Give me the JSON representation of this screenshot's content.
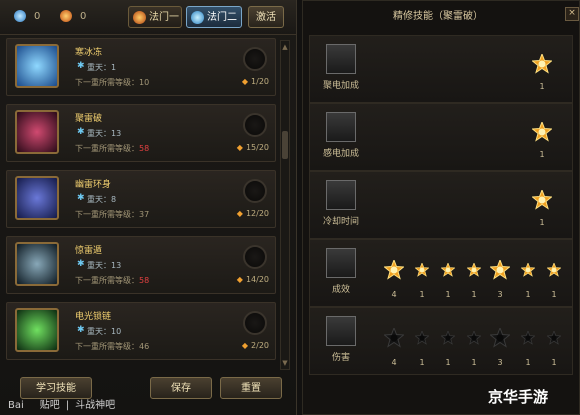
{
  "left_panel": {
    "resources": [
      {
        "icon": "blue-gem-icon",
        "value": "0",
        "color": "#5ab8f0"
      },
      {
        "icon": "fire-crystal-icon",
        "value": "0",
        "color": "#f08c30"
      }
    ],
    "tabs": [
      {
        "label": "法门一",
        "active": false,
        "icon": "fire-swirl-icon"
      },
      {
        "label": "法门二",
        "active": true,
        "icon": "water-swirl-icon"
      }
    ],
    "activate_label": "激活",
    "skills": [
      {
        "name": "寒冰冻",
        "level": "重天：1",
        "req_prefix": "下一重所需等级：",
        "req_level": "10",
        "req_red": false,
        "count": "1/20",
        "icon": "ice-crystal-icon",
        "colors": [
          "#8fd8ff",
          "#1b4a8a"
        ]
      },
      {
        "name": "聚雷破",
        "level": "重天：13",
        "req_prefix": "下一重所需等级：",
        "req_level": "58",
        "req_red": true,
        "count": "15/20",
        "icon": "thunder-eye-icon",
        "colors": [
          "#d04a70",
          "#2a0a18"
        ]
      },
      {
        "name": "幽雷环身",
        "level": "重天：8",
        "req_prefix": "下一重所需等级：",
        "req_level": "37",
        "req_red": false,
        "count": "12/20",
        "icon": "armor-aura-icon",
        "colors": [
          "#6a78d8",
          "#141a48"
        ]
      },
      {
        "name": "惊雷遁",
        "level": "重天：13",
        "req_prefix": "下一重所需等级：",
        "req_level": "58",
        "req_red": true,
        "count": "14/20",
        "icon": "phantom-figure-icon",
        "colors": [
          "#88a8b8",
          "#0e1a22"
        ]
      },
      {
        "name": "电光锁链",
        "level": "重天：10",
        "req_prefix": "下一重所需等级：",
        "req_level": "46",
        "req_red": false,
        "count": "2/20",
        "icon": "lightning-chain-icon",
        "colors": [
          "#70e060",
          "#0c2a10"
        ]
      }
    ],
    "buttons": {
      "learn": "学习技能",
      "save": "保存",
      "reset": "重置"
    }
  },
  "right_panel": {
    "title": "精修技能（聚雷破）",
    "rows": [
      {
        "label": "聚电加成",
        "icon": "thunder-crest-icon",
        "stars": [
          {
            "value": "1",
            "lit": true,
            "big": true
          }
        ],
        "align": "right"
      },
      {
        "label": "感电加成",
        "icon": "thunder-crest-icon",
        "stars": [
          {
            "value": "1",
            "lit": true,
            "big": true
          }
        ],
        "align": "right"
      },
      {
        "label": "冷却时间",
        "icon": "lightning-bolt-icon",
        "stars": [
          {
            "value": "1",
            "lit": true,
            "big": true
          }
        ],
        "align": "right"
      },
      {
        "label": "成效",
        "icon": "thunder-crest-icon",
        "stars": [
          {
            "value": "4",
            "lit": true,
            "big": true
          },
          {
            "value": "1",
            "lit": true,
            "big": false
          },
          {
            "value": "1",
            "lit": true,
            "big": false
          },
          {
            "value": "1",
            "lit": true,
            "big": false
          },
          {
            "value": "3",
            "lit": true,
            "big": true
          },
          {
            "value": "1",
            "lit": true,
            "big": false
          },
          {
            "value": "1",
            "lit": true,
            "big": false
          }
        ],
        "align": "spread"
      },
      {
        "label": "伤害",
        "icon": "lightning-bolt-icon",
        "stars": [
          {
            "value": "4",
            "lit": false,
            "big": true
          },
          {
            "value": "1",
            "lit": false,
            "big": false
          },
          {
            "value": "1",
            "lit": false,
            "big": false
          },
          {
            "value": "1",
            "lit": false,
            "big": false
          },
          {
            "value": "3",
            "lit": false,
            "big": true
          },
          {
            "value": "1",
            "lit": false,
            "big": false
          },
          {
            "value": "1",
            "lit": false,
            "big": false
          }
        ],
        "align": "spread"
      }
    ]
  },
  "watermarks": {
    "baidu": "Bai",
    "baidu_suffix": "贴吧",
    "forum": "斗战神吧",
    "brand": "京华手游"
  }
}
